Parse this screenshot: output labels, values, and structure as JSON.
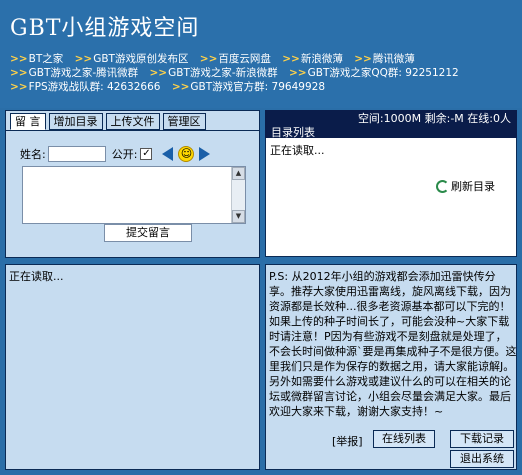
{
  "header": {
    "title": "GBT小组游戏空间",
    "links": [
      {
        "arrow": ">>",
        "label": "BT之家"
      },
      {
        "arrow": ">>",
        "label": "GBT游戏原创发布区"
      },
      {
        "arrow": ">>",
        "label": "百度云网盘"
      },
      {
        "arrow": ">>",
        "label": "新浪微薄"
      },
      {
        "arrow": ">>",
        "label": "腾讯微薄"
      },
      {
        "arrow": ">>",
        "label": "GBT游戏之家-腾讯微群"
      },
      {
        "arrow": ">>",
        "label": "GBT游戏之家-新浪微群"
      },
      {
        "arrow": ">>",
        "label": "GBT游戏之家QQ群: 92251212"
      },
      {
        "arrow": ">>",
        "label": "FPS游戏战队群: 42632666"
      },
      {
        "arrow": ">>",
        "label": "GBT游戏官方群: 79649928"
      }
    ]
  },
  "tabs": [
    "留 言",
    "增加目录",
    "上传文件",
    "管理区"
  ],
  "form": {
    "name_label": "姓名:",
    "public_label": "公开:",
    "public_checked": "✓",
    "submit_label": "提交留言"
  },
  "chat": {
    "loading": "正在读取..."
  },
  "status": {
    "space": "空间:1000M 剩余:-M 在线:0人",
    "dir_label": "目录列表"
  },
  "dir": {
    "loading": "正在读取...",
    "refresh_label": "刷新目录"
  },
  "notice": {
    "text": "P.S: 从2012年小组的游戏都会添加迅雷快传分享。推荐大家使用迅雷离线，旋风离线下载，因为资源都是长效种...很多老资源基本都可以下完的！如果上传的种子时间长了，可能会没种~大家下载时请注意！P因为有些游戏不是刻盘就是处理了，不会长时间做种源`要是再集成种子不是很方便。这里我们只是作为保存的数据之用，请大家能谅解J。另外如需要什么游戏或建议什么的可以在相关的论坛或微群留言讨论，小组会尽量会满足大家。最后欢迎大家来下载，谢谢大家支持！~",
    "report_label": "[举报]",
    "online_label": "在线列表",
    "downloads_label": "下载记录",
    "exit_label": "退出系统"
  }
}
